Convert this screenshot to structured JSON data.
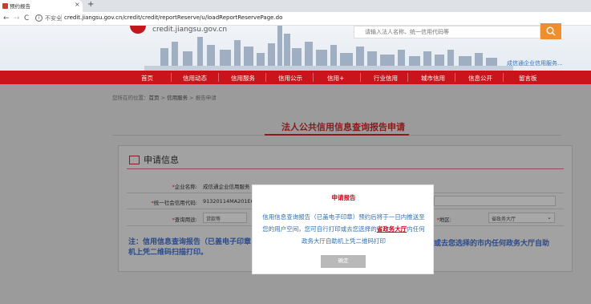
{
  "browser": {
    "tab_title": "预约报告",
    "tab_close": "×",
    "new_tab": "+",
    "back": "←",
    "forward": "→",
    "reload": "C",
    "insecure_badge": "i",
    "insecure_label": "不安全",
    "url": "credit.jiangsu.gov.cn/credit/credit/reportReserve/u/loadReportReservePage.do"
  },
  "site": {
    "domain": "credit.jiangsu.gov.cn",
    "search_placeholder": "请输入法人名称、统一信用代码等",
    "header_link": "成信通企业信用服务...",
    "nav": [
      "首页",
      "信用动态",
      "信用服务",
      "信用公示",
      "信用+",
      "行业信用",
      "城市信用",
      "信息公开",
      "留言板"
    ]
  },
  "breadcrumb": {
    "prefix": "您所在的位置：",
    "home": "首页",
    "sep1": " > ",
    "section": "信用服务",
    "sep2": " > ",
    "current": "报告申请"
  },
  "page": {
    "title": "法人公共信用信息查询报告申请",
    "panel_title": "申请信息"
  },
  "form": {
    "company_label": "企业名称:",
    "company_value": "成信通企业信用服务",
    "credit_code_label": "统一社会信用代码:",
    "credit_code_value": "91320114MA201E6",
    "purpose_label": "查询用途:",
    "purpose_value": "贷款等",
    "region_label": "地区:",
    "region_value": "省政务大厅",
    "req_mark": "*"
  },
  "note": {
    "left": "注：信用信息查询报告（已盖电子印章",
    "left2": "机上凭二维码扫描打印。",
    "right": "或去您选择的市内任何政务大厅自助"
  },
  "modal": {
    "title": "申请报告",
    "body_1": "信用信息查询报告（已盖电子印章）预约后将于一日内推送至您的用户空间，您可自行打印或去您选择的",
    "highlight": "省政务大厅",
    "body_2": "内任何政务大厅自助机上凭二维码打印",
    "button": "确定"
  },
  "colors": {
    "brand_red": "#c8141a",
    "title_red": "#8b1a1a",
    "link_blue": "#2f6fb2",
    "search_orange": "#ef8e2c"
  }
}
